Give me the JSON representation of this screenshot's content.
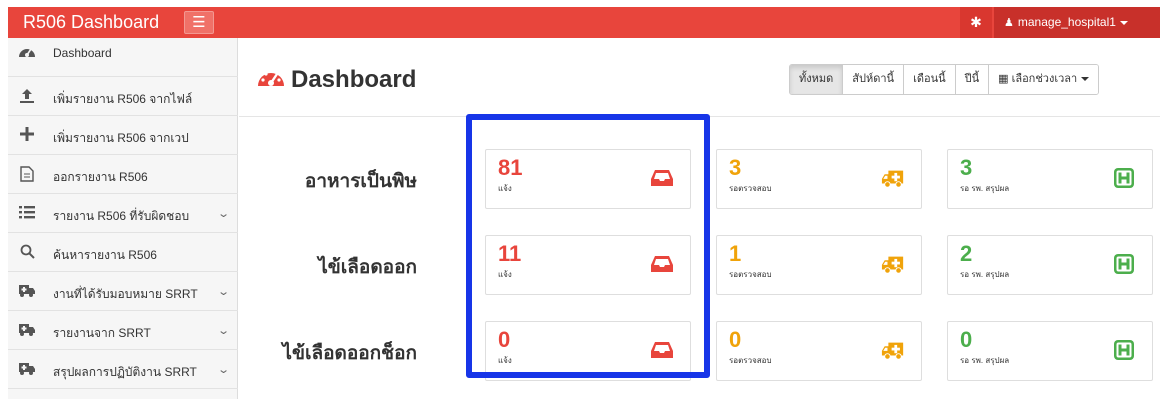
{
  "app": {
    "brand": "R506 Dashboard",
    "menu_icon": "hamburger-icon",
    "settings_icon": "gear-icon",
    "user": "manage_hospital1",
    "accent": "#e8453c"
  },
  "sidebar": {
    "items": [
      {
        "icon": "dashboard-icon",
        "label": "Dashboard",
        "has_chevron": false
      },
      {
        "icon": "upload-icon",
        "label": "เพิ่มรายงาน R506 จากไฟล์",
        "has_chevron": false
      },
      {
        "icon": "plus-icon",
        "label": "เพิ่มรายงาน R506 จากเวป",
        "has_chevron": false
      },
      {
        "icon": "file-icon",
        "label": "ออกรายงาน R506",
        "has_chevron": false
      },
      {
        "icon": "list-icon",
        "label": "รายงาน R506 ที่รับผิดชอบ",
        "has_chevron": true
      },
      {
        "icon": "search-icon",
        "label": "ค้นหารายงาน R506",
        "has_chevron": false
      },
      {
        "icon": "ambulance-icon",
        "label": "งานที่ได้รับมอบหมาย SRRT",
        "has_chevron": true
      },
      {
        "icon": "ambulance-icon",
        "label": "รายงานจาก SRRT",
        "has_chevron": true
      },
      {
        "icon": "ambulance-icon",
        "label": "สรุปผลการปฏิบัติงาน SRRT",
        "has_chevron": true
      }
    ]
  },
  "main": {
    "title": "Dashboard",
    "title_icon": "dashboard-icon",
    "filters": [
      "ทั้งหมด",
      "สัปห์ดานี้",
      "เดือนนี้",
      "ปีนี้",
      "เลือกช่วงเวลา"
    ],
    "filter_active": "ทั้งหมด",
    "rows": [
      {
        "label": "อาหารเป็นพิษ",
        "cards": [
          {
            "value": "81",
            "sub": "แจ้ง",
            "icon": "inbox-icon",
            "color": "#e8453c"
          },
          {
            "value": "3",
            "sub": "รอตรวจสอบ",
            "icon": "ambulance-icon",
            "color": "#f0a30a"
          },
          {
            "value": "3",
            "sub": "รอ รพ. สรุปผล",
            "icon": "hospital-icon",
            "color": "#4cae4c"
          }
        ]
      },
      {
        "label": "ไข้เลือดออก",
        "cards": [
          {
            "value": "11",
            "sub": "แจ้ง",
            "icon": "inbox-icon",
            "color": "#e8453c"
          },
          {
            "value": "1",
            "sub": "รอตรวจสอบ",
            "icon": "ambulance-icon",
            "color": "#f0a30a"
          },
          {
            "value": "2",
            "sub": "รอ รพ. สรุปผล",
            "icon": "hospital-icon",
            "color": "#4cae4c"
          }
        ]
      },
      {
        "label": "ไข้เลือดออกช็อก",
        "cards": [
          {
            "value": "0",
            "sub": "แจ้ง",
            "icon": "inbox-icon",
            "color": "#e8453c"
          },
          {
            "value": "0",
            "sub": "รอตรวจสอบ",
            "icon": "ambulance-icon",
            "color": "#f0a30a"
          },
          {
            "value": "0",
            "sub": "รอ รพ. สรุปผล",
            "icon": "hospital-icon",
            "color": "#4cae4c"
          }
        ]
      }
    ]
  },
  "annotation": {
    "color": "#1735e8"
  }
}
